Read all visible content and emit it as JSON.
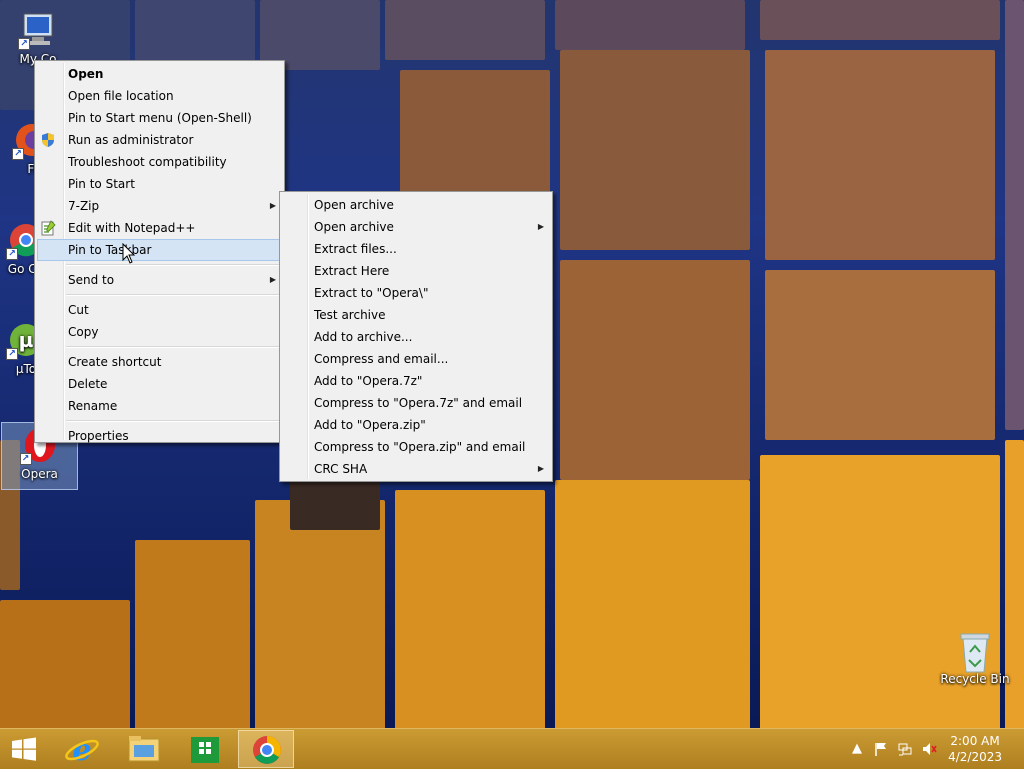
{
  "desktop": {
    "icons": [
      {
        "label": "My Co"
      },
      {
        "label": "Fi"
      },
      {
        "label": "Go Ch"
      },
      {
        "label": "µTo"
      },
      {
        "label": "Opera"
      },
      {
        "label": "Recycle Bin"
      }
    ]
  },
  "context_menu": {
    "items": [
      {
        "label": "Open"
      },
      {
        "label": "Open file location"
      },
      {
        "label": "Pin to Start menu (Open-Shell)"
      },
      {
        "label": "Run as administrator"
      },
      {
        "label": "Troubleshoot compatibility"
      },
      {
        "label": "Pin to Start"
      },
      {
        "label": "7-Zip"
      },
      {
        "label": "Edit with Notepad++"
      },
      {
        "label": "Pin to Taskbar"
      },
      {
        "label": "Send to"
      },
      {
        "label": "Cut"
      },
      {
        "label": "Copy"
      },
      {
        "label": "Create shortcut"
      },
      {
        "label": "Delete"
      },
      {
        "label": "Rename"
      },
      {
        "label": "Properties"
      }
    ]
  },
  "submenu_7zip": {
    "items": [
      {
        "label": "Open archive"
      },
      {
        "label": "Open archive"
      },
      {
        "label": "Extract files..."
      },
      {
        "label": "Extract Here"
      },
      {
        "label": "Extract to \"Opera\\\""
      },
      {
        "label": "Test archive"
      },
      {
        "label": "Add to archive..."
      },
      {
        "label": "Compress and email..."
      },
      {
        "label": "Add to \"Opera.7z\""
      },
      {
        "label": "Compress to \"Opera.7z\" and email"
      },
      {
        "label": "Add to \"Opera.zip\""
      },
      {
        "label": "Compress to \"Opera.zip\" and email"
      },
      {
        "label": "CRC SHA"
      }
    ]
  },
  "taskbar": {
    "pinned": [
      "start-icon",
      "internet-explorer-icon",
      "file-explorer-icon",
      "store-icon",
      "chrome-icon"
    ],
    "clock": {
      "time": "2:00 AM",
      "date": "4/2/2023"
    }
  },
  "colors": {
    "highlight": "#d5e4f5",
    "menu_bg": "#f0f0f0",
    "taskbar": "#c8962a"
  }
}
